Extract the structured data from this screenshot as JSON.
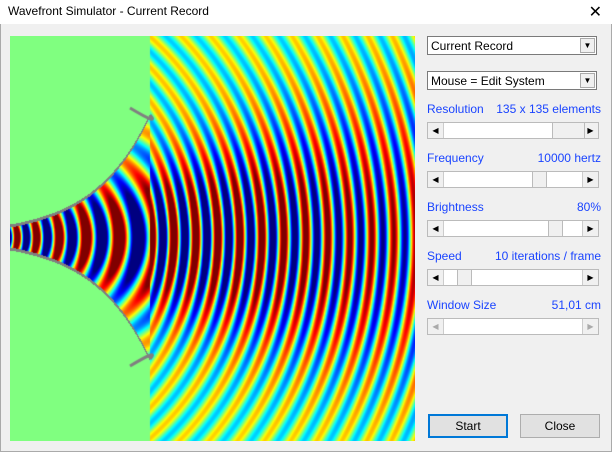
{
  "window": {
    "title": "Wavefront Simulator - Current Record",
    "close_glyph": "✕"
  },
  "record_select": {
    "value": "Current Record"
  },
  "mouse_select": {
    "value": "Mouse = Edit System"
  },
  "controls": [
    {
      "label": "Resolution",
      "value": "135 x 135 elements",
      "position": 1.0,
      "enabled": true
    },
    {
      "label": "Frequency",
      "value": "10000 hertz",
      "position": 0.7,
      "enabled": true
    },
    {
      "label": "Brightness",
      "value": "80%",
      "position": 0.83,
      "enabled": true
    },
    {
      "label": "Speed",
      "value": "10 iterations / frame",
      "position": 0.1,
      "enabled": true
    },
    {
      "label": "Window Size",
      "value": "51,01 cm",
      "position": null,
      "enabled": false
    }
  ],
  "buttons": {
    "start": "Start",
    "close": "Close"
  },
  "colors": {
    "label": "#1a44ff",
    "background": "#80ff80"
  }
}
